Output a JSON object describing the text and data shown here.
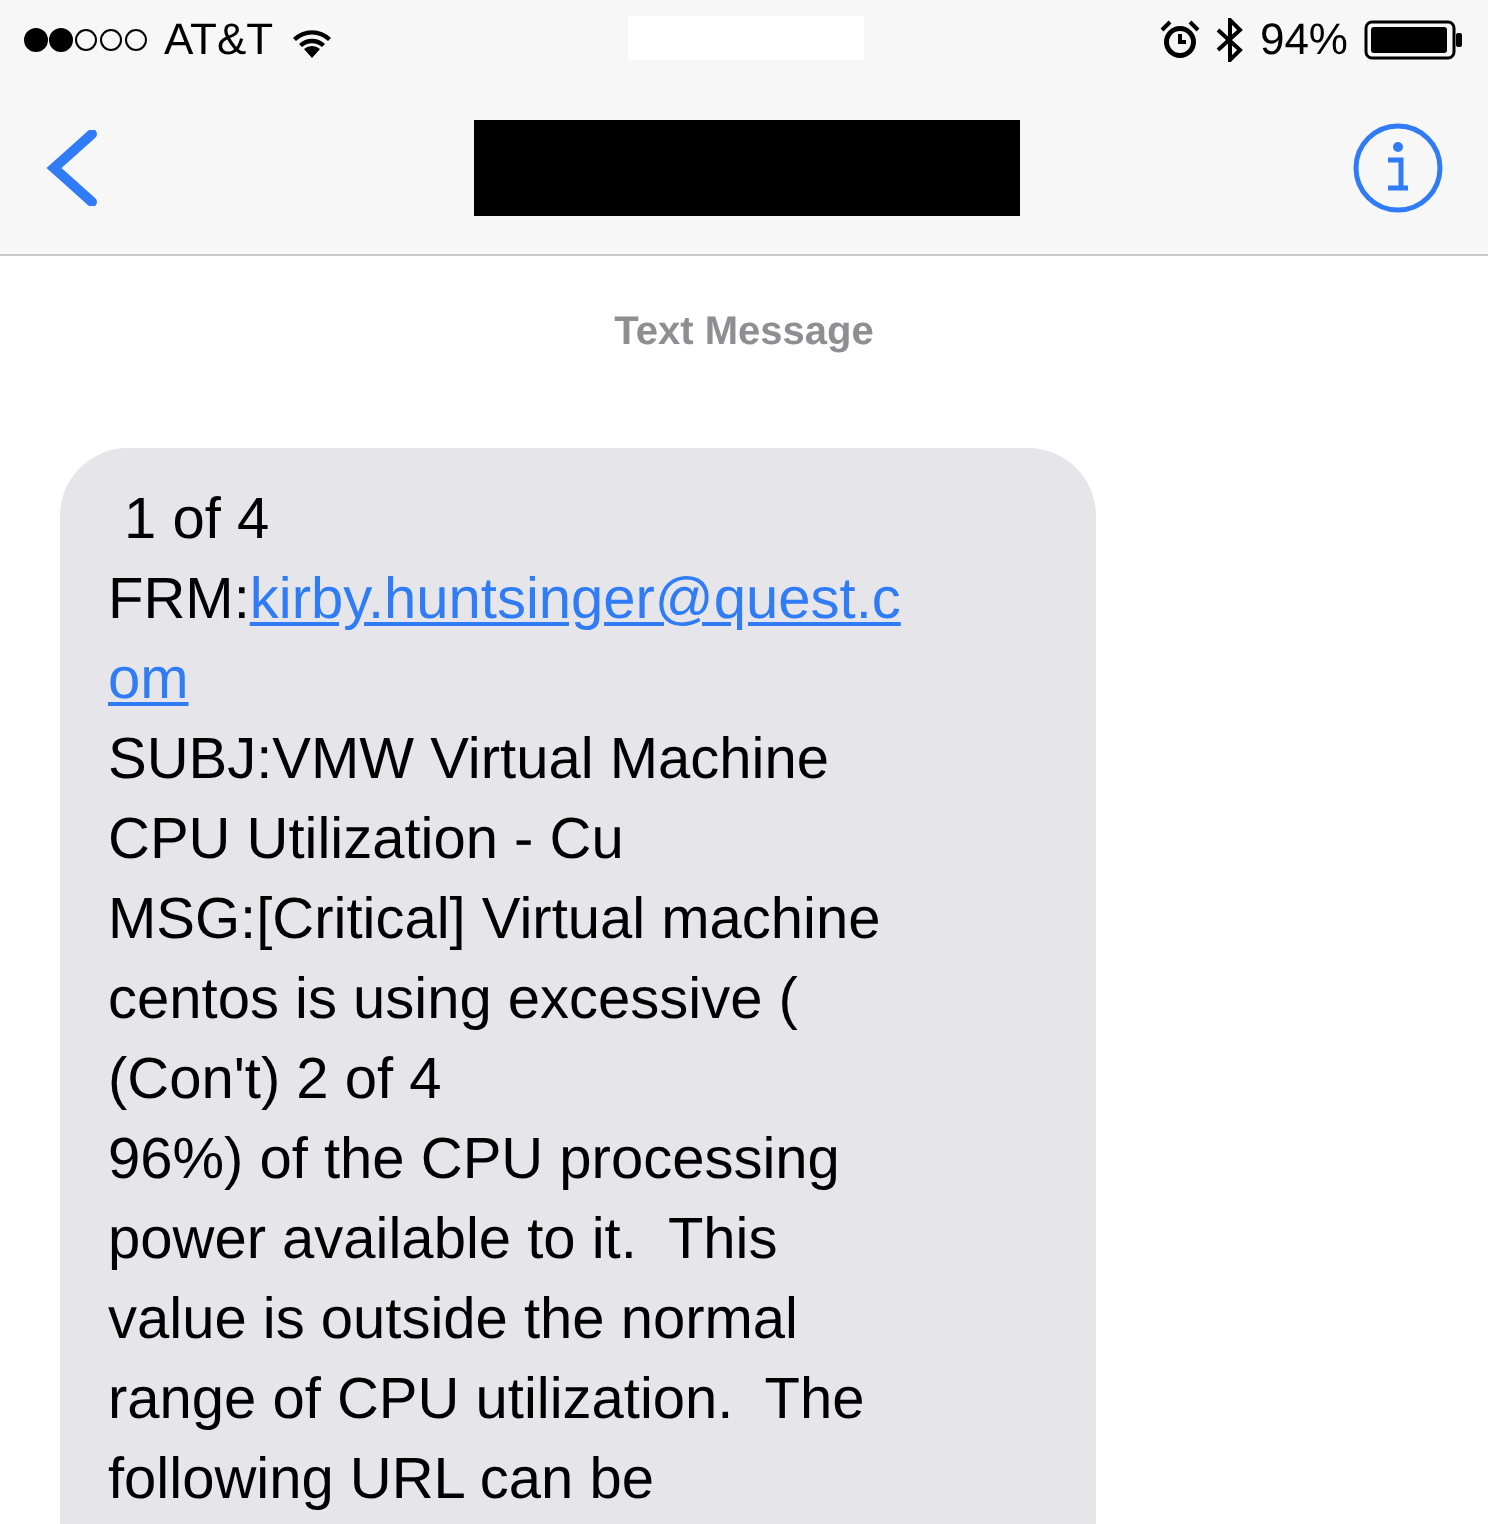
{
  "status_bar": {
    "carrier": "AT&T",
    "battery": "94%"
  },
  "conversation": {
    "label": "Text Message"
  },
  "message": {
    "lines": [
      {
        "kind": "text",
        "text": " 1 of 4"
      },
      {
        "kind": "link",
        "prefix": "FRM:",
        "link": "kirby.huntsinger@quest.c"
      },
      {
        "kind": "link",
        "link": "om"
      },
      {
        "kind": "text",
        "text": "SUBJ:VMW Virtual Machine"
      },
      {
        "kind": "text",
        "text": "CPU Utilization - Cu"
      },
      {
        "kind": "text",
        "text": "MSG:[Critical] Virtual machine"
      },
      {
        "kind": "text",
        "text": "centos is using excessive ("
      },
      {
        "kind": "text",
        "text": "(Con't) 2 of 4"
      },
      {
        "kind": "text",
        "text": "96%) of the CPU processing"
      },
      {
        "kind": "text",
        "text": "power available to it.  This"
      },
      {
        "kind": "text",
        "text": "value is outside the normal"
      },
      {
        "kind": "text",
        "text": "range of CPU utilization.  The"
      },
      {
        "kind": "text",
        "text": "following URL can be"
      }
    ]
  }
}
